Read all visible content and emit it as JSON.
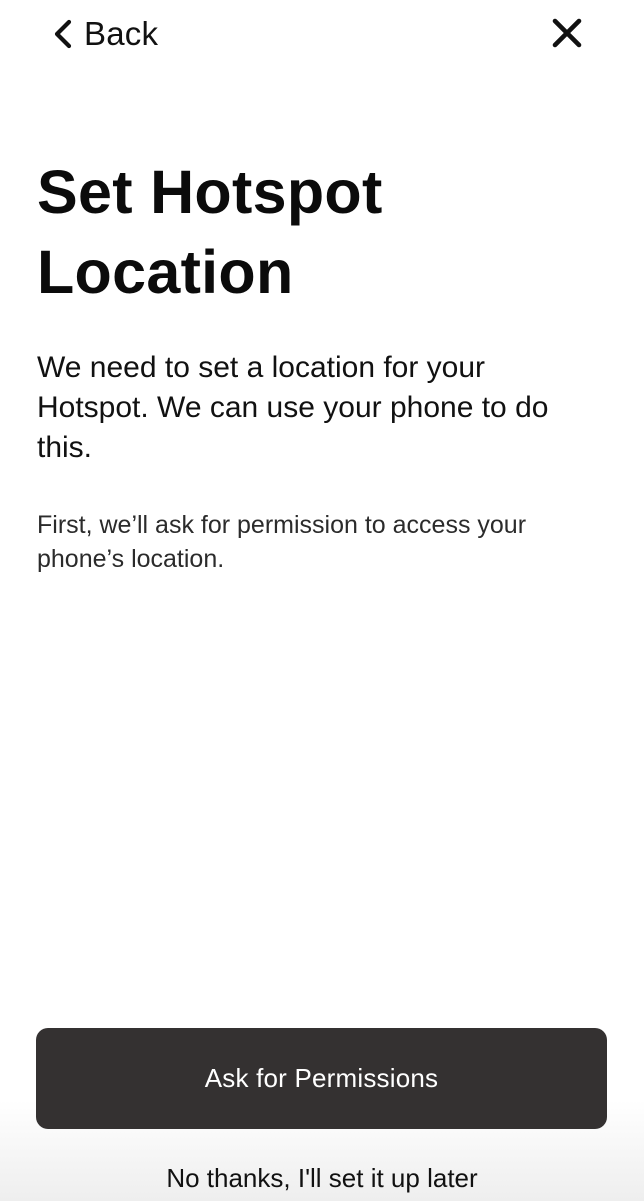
{
  "nav": {
    "back_label": "Back",
    "back_icon": "chevron-left-icon",
    "close_icon": "close-icon"
  },
  "main": {
    "title": "Set Hotspot Location",
    "lead": "We need to set a location for your Hotspot. We can use your phone to do this.",
    "note": "First, we’ll ask for permission to access your phone’s location."
  },
  "actions": {
    "primary_label": "Ask for Permissions",
    "secondary_label": "No thanks, I'll set it up later"
  },
  "colors": {
    "background": "#ffffff",
    "text": "#111111",
    "primary_button": "#343131",
    "primary_button_text": "#ffffff"
  }
}
